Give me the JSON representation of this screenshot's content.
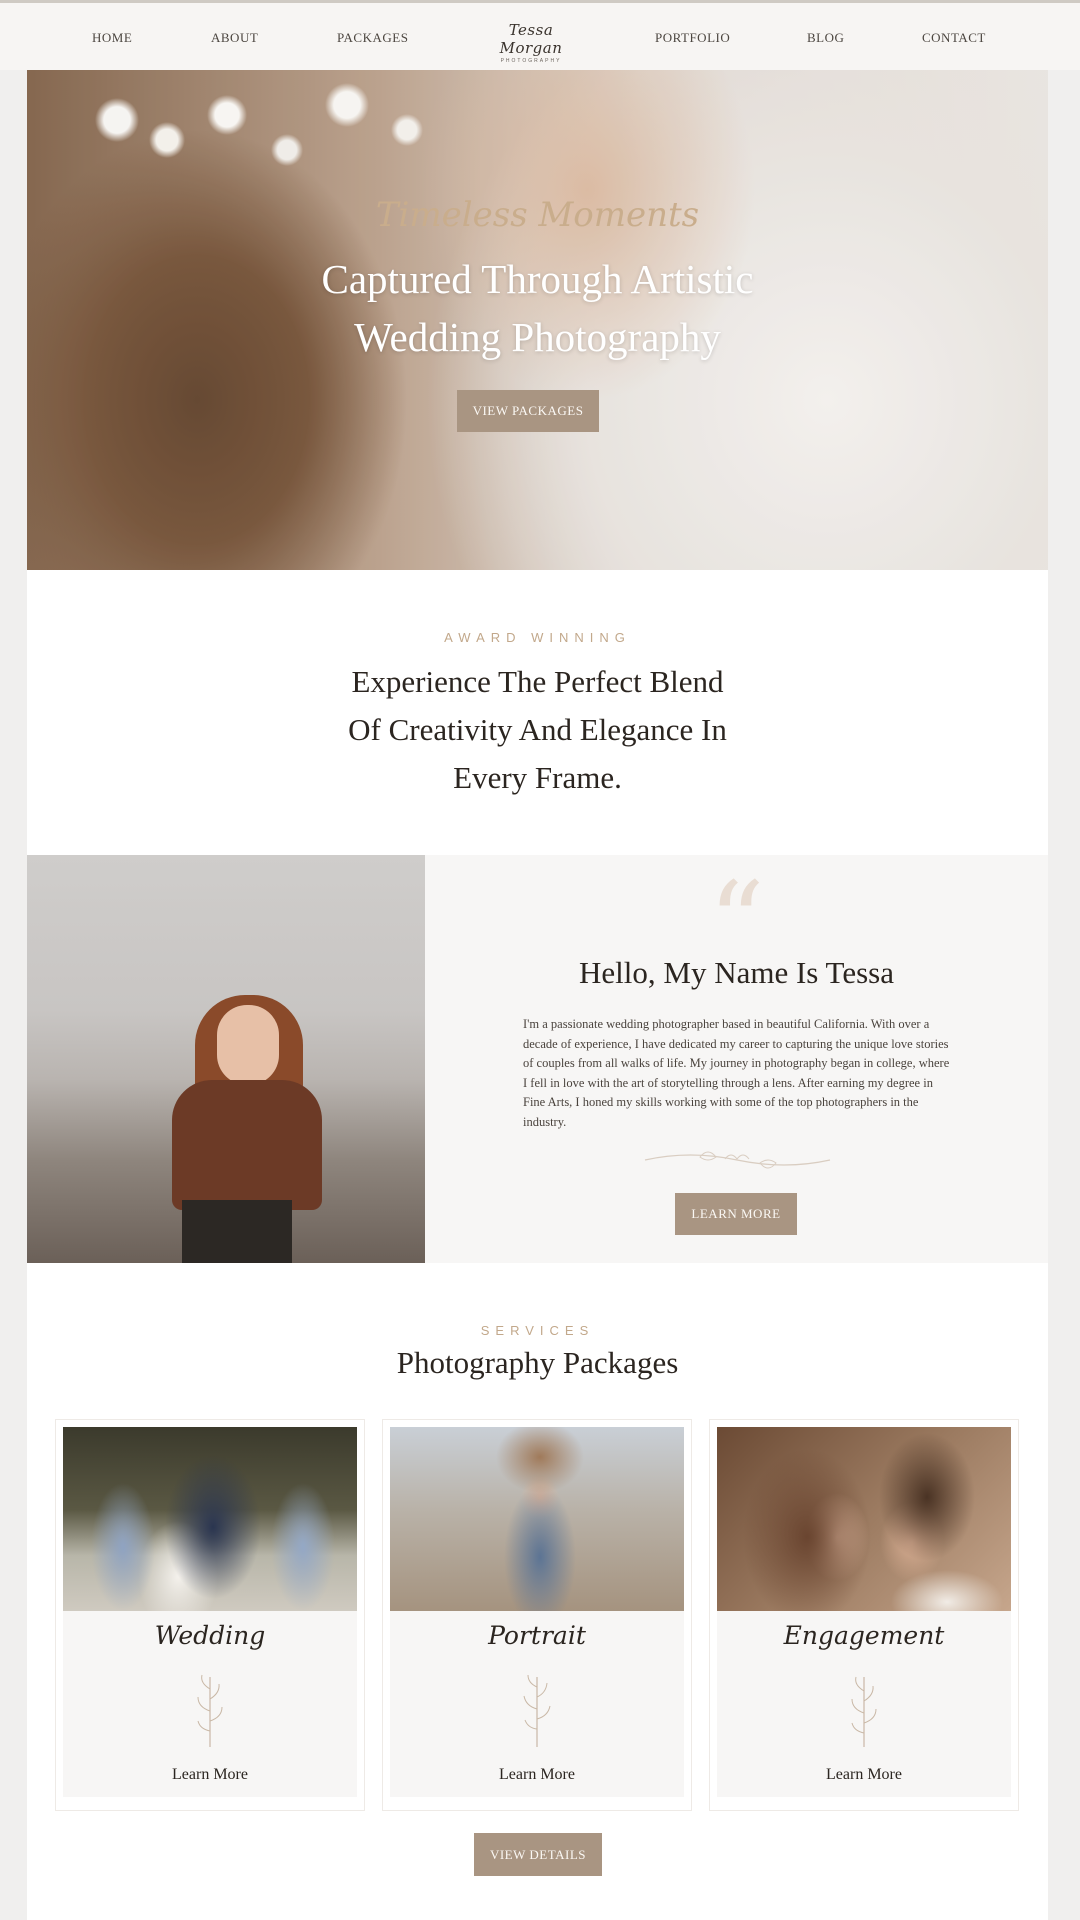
{
  "nav": {
    "items_left": [
      "HOME",
      "ABOUT",
      "PACKAGES"
    ],
    "logo_script": "Tessa Morgan",
    "logo_sub": "PHOTOGRAPHY",
    "items_right": [
      "PORTFOLIO",
      "BLOG",
      "CONTACT"
    ]
  },
  "hero": {
    "script": "Timeless Moments",
    "title_line1": "Captured Through Artistic",
    "title_line2": "Wedding Photography",
    "button": "VIEW PACKAGES"
  },
  "intro": {
    "eyebrow": "AWARD WINNING",
    "line1": "Experience The Perfect Blend",
    "line2": "Of Creativity And Elegance In",
    "line3": "Every Frame."
  },
  "about": {
    "quote_icon": "“",
    "heading": "Hello, My Name Is Tessa",
    "body": "I'm a passionate wedding photographer based in beautiful California. With over a decade of experience, I have dedicated my career to capturing the unique love stories of couples from all walks of life. My journey in photography began in college, where I fell in love with the art of storytelling through a lens. After earning my degree in Fine Arts, I honed my skills working with some of the top photographers in the industry.",
    "button": "LEARN MORE"
  },
  "services": {
    "eyebrow": "SERVICES",
    "title": "Photography Packages",
    "cards": [
      {
        "title": "Wedding",
        "link": "Learn More"
      },
      {
        "title": "Portrait",
        "link": "Learn More"
      },
      {
        "title": "Engagement",
        "link": "Learn More"
      }
    ],
    "button": "VIEW DETAILS"
  },
  "colors": {
    "accent": "#a99582",
    "eyebrow": "#c2a88b",
    "script_gold": "#c9ad8c",
    "panel_bg": "#f7f6f5"
  }
}
